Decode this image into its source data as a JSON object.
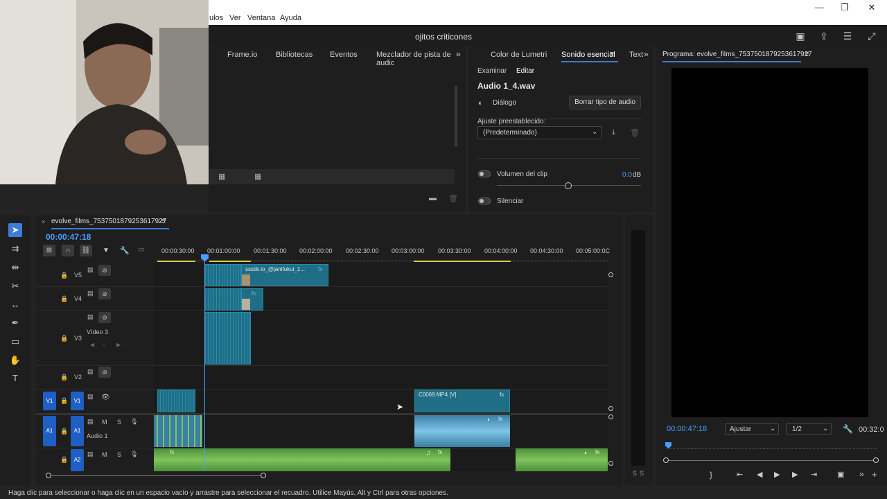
{
  "menu": {
    "items": [
      "ulos",
      "Ver",
      "Ventana",
      "Ayuda"
    ]
  },
  "window_controls": {
    "minimize": "—",
    "restore": "❐",
    "close": "✕"
  },
  "app": {
    "title": "ojitos criticones"
  },
  "left_panel": {
    "tabs": [
      "Frame.io",
      "Bibliotecas",
      "Eventos",
      "Mezclador de pista de audic"
    ]
  },
  "essential_sound": {
    "tabs": [
      "Color de Lumetri",
      "Sonido esencial",
      "Text"
    ],
    "subtabs": [
      "Examinar",
      "Editar"
    ],
    "clip_name": "Audio 1_4.wav",
    "audio_type": "Diálogo",
    "clear_button": "Borrar tipo de audio",
    "preset_label": "Ajuste preestablecido:",
    "preset_value": "(Predeterminado)",
    "clip_volume_label": "Volumen del clip",
    "clip_volume_value": "0.0",
    "clip_volume_unit": "dB",
    "mute_label": "Silenciar"
  },
  "program": {
    "title": "Programa: evolve_films_7537501879253617927",
    "timecode": "00:00:47:18",
    "fit": "Ajustar",
    "resolution": "1/2",
    "duration": "00:32:0"
  },
  "timeline": {
    "sequence_name": "evolve_films_7537501879253617927",
    "timecode": "00:00:47:18",
    "ruler": [
      "00:00:30:00",
      "00:01:00:00",
      "00:01:30:00",
      "00:02:00:00",
      "00:02:30:00",
      "00:03:00:00",
      "00:03:30:00",
      "00:04:00:00",
      "00:04:30:00",
      "00:05:00:0C"
    ],
    "tracks": {
      "v5": "V5",
      "v4": "V4",
      "v3": "V3",
      "v3_name": "Vídeo 3",
      "v2": "V2",
      "v1": "V1",
      "v1_src": "V1",
      "a1": "A1",
      "a1_src": "A1",
      "a1_name": "Audio 1",
      "a2": "A2",
      "m": "M",
      "s": "S"
    },
    "clips": {
      "v5_clip": "ssstik.io_@janifukui_1...",
      "v1_clip": "C0069.MP4 [V]",
      "fx": "fx"
    }
  },
  "meter": {
    "labels": [
      "S",
      "S"
    ]
  },
  "status": {
    "text": "Haga clic para seleccionar o haga clic en un espacio vacío y arrastre para seleccionar el recuadro. Utilice Mayús, Alt y Ctrl para otras opciones."
  }
}
